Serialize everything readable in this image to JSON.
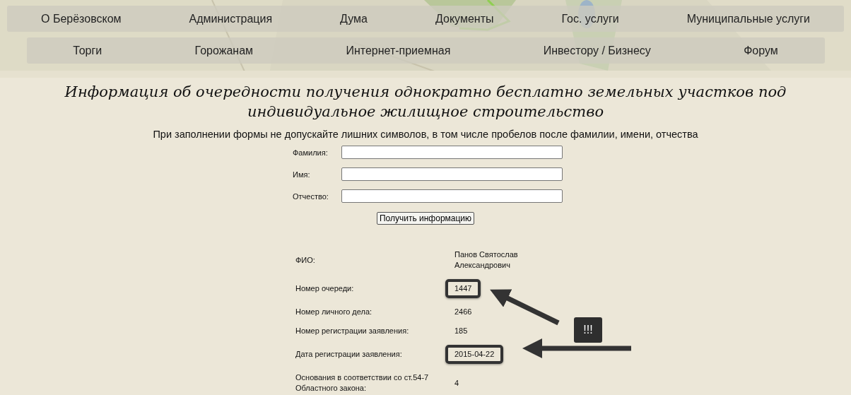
{
  "nav_primary": [
    {
      "label": "О Берёзовском"
    },
    {
      "label": "Администрация"
    },
    {
      "label": "Дума"
    },
    {
      "label": "Документы"
    },
    {
      "label": "Гос. услуги"
    },
    {
      "label": "Муниципальные услуги"
    }
  ],
  "nav_secondary": [
    {
      "label": "Торги"
    },
    {
      "label": "Горожанам"
    },
    {
      "label": "Интернет-приемная"
    },
    {
      "label": "Инвестору / Бизнесу"
    },
    {
      "label": "Форум"
    }
  ],
  "title": "Информация об очередности получения однократно бесплатно земельных участков под индивидуальное жилищное строительство",
  "note": "При заполнении формы не допускайте лишних символов, в том числе пробелов после фамилии, имени, отчества",
  "form": {
    "fields": [
      {
        "label": "Фамилия:"
      },
      {
        "label": "Имя:"
      },
      {
        "label": "Отчество:"
      }
    ],
    "submit": "Получить информацию"
  },
  "results": [
    {
      "label": "ФИО:",
      "value": "Панов Святослав Александрович",
      "highlighted": false
    },
    {
      "label": "Номер очереди:",
      "value": "1447",
      "highlighted": true
    },
    {
      "label": "Номер личного дела:",
      "value": "2466",
      "highlighted": false
    },
    {
      "label": "Номер регистрации заявления:",
      "value": "185",
      "highlighted": false
    },
    {
      "label": "Дата регистрации заявления:",
      "value": "2015-04-22",
      "highlighted": true
    },
    {
      "label": "Основания в соответствии со ст.54-7 Областного закона:",
      "value": "4",
      "highlighted": false
    }
  ],
  "annotation_badge": "!!!"
}
